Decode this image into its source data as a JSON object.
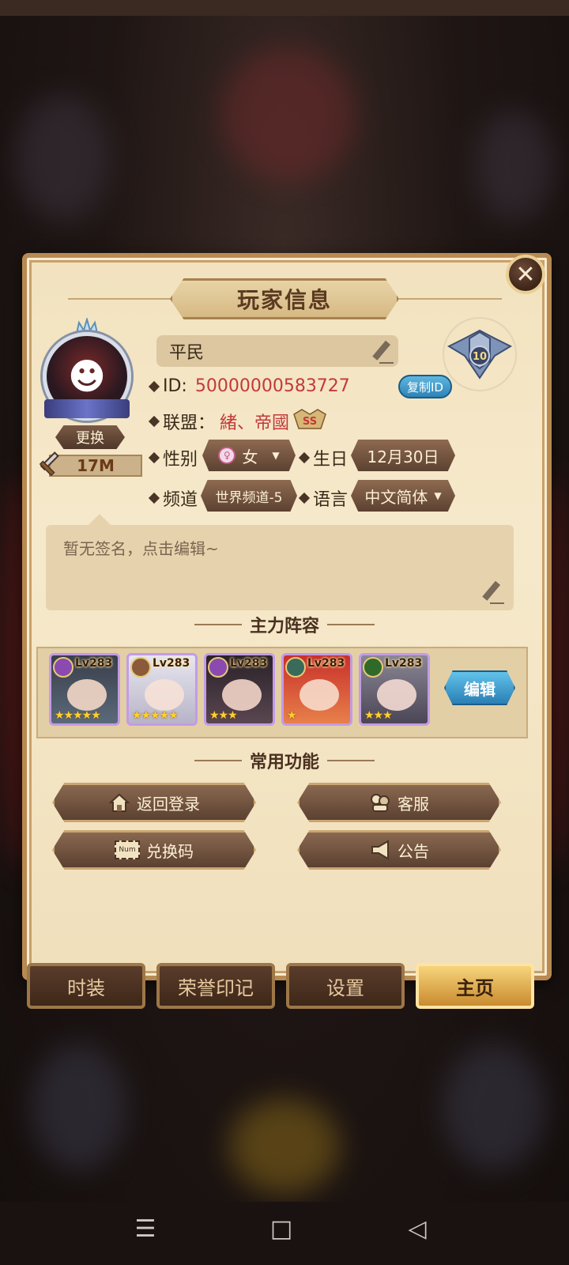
{
  "dialog": {
    "title": "玩家信息",
    "close_icon": "close-icon"
  },
  "profile": {
    "avatar_change_label": "更换",
    "power": "17M",
    "name": "平民",
    "id_label": "ID:",
    "id_value": "50000000583727",
    "copy_id_label": "复制ID",
    "alliance_label": "联盟：",
    "alliance_value": "緒、帝國",
    "alliance_badge": "SS",
    "rank_level": "10",
    "gender_label": "性别",
    "gender_value": "女",
    "birthday_label": "生日",
    "birthday_value": "12月30日",
    "channel_label": "频道",
    "channel_value": "世界频道-5",
    "language_label": "语言",
    "language_value": "中文简体",
    "signature_placeholder": "暂无签名，点击编辑~"
  },
  "team": {
    "section_title": "主力阵容",
    "edit_label": "编辑",
    "heroes": [
      {
        "level": "Lv283",
        "stars": "★★★★★",
        "faction_color": "#8a4ab0",
        "frame_color": "#c39be6"
      },
      {
        "level": "Lv283",
        "stars": "★★★★★",
        "faction_color": "#8a5a3a",
        "frame_color": "#c39be6"
      },
      {
        "level": "Lv283",
        "stars": "★★★",
        "faction_color": "#8a4ab0",
        "frame_color": "#c39be6"
      },
      {
        "level": "Lv283",
        "stars": "★",
        "faction_color": "#3a6a5a",
        "frame_color": "#c39be6"
      },
      {
        "level": "Lv283",
        "stars": "★★★",
        "faction_color": "#2f6a2a",
        "frame_color": "#c39be6"
      }
    ]
  },
  "functions": {
    "section_title": "常用功能",
    "return_login": "返回登录",
    "customer_service": "客服",
    "redeem_code": "兑换码",
    "redeem_icon_text": "Num",
    "announcement": "公告"
  },
  "tabs": [
    {
      "label": "时装"
    },
    {
      "label": "荣誉印记"
    },
    {
      "label": "设置"
    },
    {
      "label": "主页"
    }
  ],
  "nav": {
    "menu_icon": "☰",
    "home_icon": "□",
    "back_icon": "◁"
  },
  "colors": {
    "accent_red": "#c23a3a",
    "button_blue": "#2d83b6",
    "panel_bg": "#f2e2bf"
  }
}
